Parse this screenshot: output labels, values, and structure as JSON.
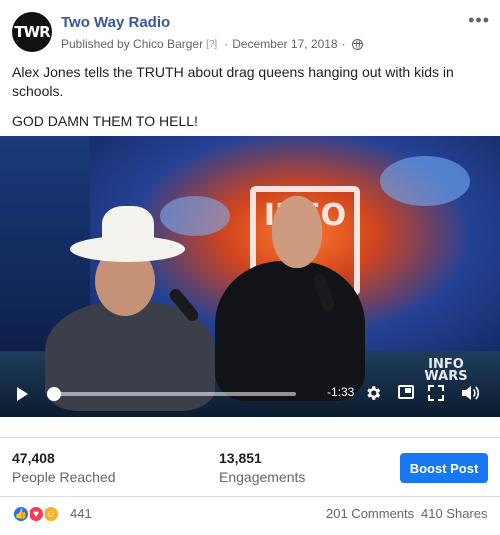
{
  "post": {
    "page_name": "Two Way Radio",
    "avatar_text": "TWR",
    "published_by": "Published by Chico Barger",
    "help_marker": "[?]",
    "separator": "·",
    "date": "December 17, 2018",
    "separator2": "·",
    "text_line1": "Alex Jones tells the TRUTH about drag queens hanging out with kids in schools.",
    "text_line2": "GOD DAMN THEM TO HELL!"
  },
  "video": {
    "time_remaining": "-1:33",
    "progress": 0.02,
    "watermark_line1": "INFO",
    "watermark_line2": "WARS",
    "logo_text": "INFO"
  },
  "stats": {
    "people_reached_value": "47,408",
    "people_reached_label": "People Reached",
    "engagements_value": "13,851",
    "engagements_label": "Engagements",
    "boost_label": "Boost Post"
  },
  "reactions": {
    "count": "441",
    "comments": "201 Comments",
    "shares": "410 Shares",
    "icons": [
      "like-icon",
      "love-icon",
      "haha-icon"
    ]
  }
}
